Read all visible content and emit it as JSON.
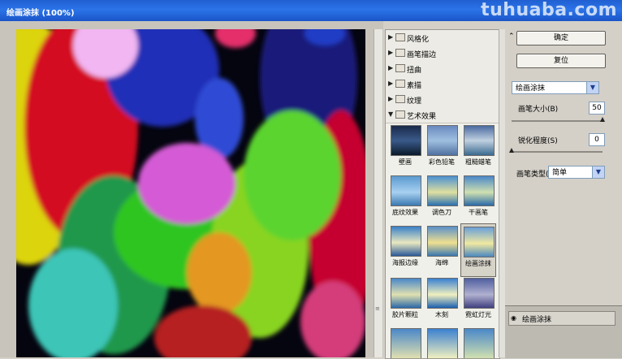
{
  "window": {
    "title": "绘画涂抹 (100%)",
    "watermark": "tuhuaba.com"
  },
  "categories": [
    {
      "label": "风格化",
      "expanded": false
    },
    {
      "label": "画笔描边",
      "expanded": false
    },
    {
      "label": "扭曲",
      "expanded": false
    },
    {
      "label": "素描",
      "expanded": false
    },
    {
      "label": "纹理",
      "expanded": false
    },
    {
      "label": "艺术效果",
      "expanded": true
    }
  ],
  "filters": [
    {
      "label": "壁画"
    },
    {
      "label": "彩色铅笔"
    },
    {
      "label": "粗糙蜡笔"
    },
    {
      "label": "底纹效果"
    },
    {
      "label": "调色刀"
    },
    {
      "label": "干画笔"
    },
    {
      "label": "海报边缘"
    },
    {
      "label": "海绵"
    },
    {
      "label": "绘画涂抹",
      "selected": true
    },
    {
      "label": "胶片颗粒"
    },
    {
      "label": "木刻"
    },
    {
      "label": "霓虹灯光"
    }
  ],
  "buttons": {
    "ok": "确定",
    "reset": "复位"
  },
  "filter_select": {
    "value": "绘画涂抹"
  },
  "params": {
    "brush_size": {
      "label": "画笔大小(B)",
      "value": "50",
      "level": 1.0
    },
    "sharpness": {
      "label": "锐化程度(S)",
      "value": "0",
      "level": 0.0
    },
    "brush_type": {
      "label": "画笔类型(I)",
      "value": "简单"
    }
  },
  "layers": [
    {
      "name": "绘画涂抹"
    }
  ],
  "icons": {
    "collapse": "double-chevron-up-icon",
    "folder": "folder-icon",
    "eye": "eye-icon"
  }
}
